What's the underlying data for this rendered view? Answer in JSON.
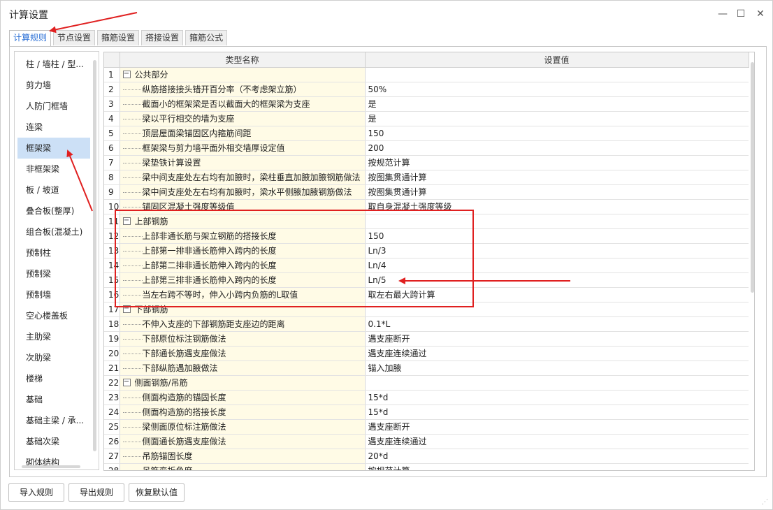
{
  "window": {
    "title": "计算设置",
    "min_glyph": "—",
    "max_glyph": "☐",
    "close_glyph": "✕"
  },
  "tabs": [
    {
      "label": "计算规则",
      "active": true
    },
    {
      "label": "节点设置",
      "active": false
    },
    {
      "label": "箍筋设置",
      "active": false
    },
    {
      "label": "搭接设置",
      "active": false
    },
    {
      "label": "箍筋公式",
      "active": false
    }
  ],
  "sidebar": {
    "items": [
      "柱 / 墙柱 / 型...",
      "剪力墙",
      "人防门框墙",
      "连梁",
      "框架梁",
      "非框架梁",
      "板 / 坡道",
      "叠合板(整厚)",
      "组合板(混凝土)",
      "预制柱",
      "预制梁",
      "预制墙",
      "空心楼盖板",
      "主肋梁",
      "次肋梁",
      "楼梯",
      "基础",
      "基础主梁 / 承...",
      "基础次梁",
      "砌体结构"
    ],
    "active_index": 4
  },
  "grid": {
    "headers": {
      "num": "",
      "name": "类型名称",
      "value": "设置值"
    },
    "rows": [
      {
        "num": "1",
        "name": "公共部分",
        "value": "",
        "group": true
      },
      {
        "num": "2",
        "name": "纵筋搭接接头错开百分率（不考虑架立筋）",
        "value": "50%",
        "group": false
      },
      {
        "num": "3",
        "name": "截面小的框架梁是否以截面大的框架梁为支座",
        "value": "是",
        "group": false
      },
      {
        "num": "4",
        "name": "梁以平行相交的墙为支座",
        "value": "是",
        "group": false
      },
      {
        "num": "5",
        "name": "顶层屋面梁锚固区内箍筋间距",
        "value": "150",
        "group": false
      },
      {
        "num": "6",
        "name": "框架梁与剪力墙平面外相交墙厚设定值",
        "value": "200",
        "group": false
      },
      {
        "num": "7",
        "name": "梁垫铁计算设置",
        "value": "按规范计算",
        "group": false
      },
      {
        "num": "8",
        "name": "梁中间支座处左右均有加腋时，梁柱垂直加腋加腋钢筋做法",
        "value": "按图集贯通计算",
        "group": false
      },
      {
        "num": "9",
        "name": "梁中间支座处左右均有加腋时，梁水平侧腋加腋钢筋做法",
        "value": "按图集贯通计算",
        "group": false
      },
      {
        "num": "10",
        "name": "锚固区混凝土强度等级值",
        "value": "取自身混凝土强度等级",
        "group": false
      },
      {
        "num": "11",
        "name": "上部钢筋",
        "value": "",
        "group": true
      },
      {
        "num": "12",
        "name": "上部非通长筋与架立钢筋的搭接长度",
        "value": "150",
        "group": false
      },
      {
        "num": "13",
        "name": "上部第一排非通长筋伸入跨内的长度",
        "value": "Ln/3",
        "group": false
      },
      {
        "num": "14",
        "name": "上部第二排非通长筋伸入跨内的长度",
        "value": "Ln/4",
        "group": false
      },
      {
        "num": "15",
        "name": "上部第三排非通长筋伸入跨内的长度",
        "value": "Ln/5",
        "group": false
      },
      {
        "num": "16",
        "name": "当左右跨不等时，伸入小跨内负筋的L取值",
        "value": "取左右最大跨计算",
        "group": false
      },
      {
        "num": "17",
        "name": "下部钢筋",
        "value": "",
        "group": true
      },
      {
        "num": "18",
        "name": "不伸入支座的下部钢筋距支座边的距离",
        "value": "0.1*L",
        "group": false
      },
      {
        "num": "19",
        "name": "下部原位标注钢筋做法",
        "value": "遇支座断开",
        "group": false
      },
      {
        "num": "20",
        "name": "下部通长筋遇支座做法",
        "value": "遇支座连续通过",
        "group": false
      },
      {
        "num": "21",
        "name": "下部纵筋遇加腋做法",
        "value": "锚入加腋",
        "group": false
      },
      {
        "num": "22",
        "name": "侧面钢筋/吊筋",
        "value": "",
        "group": true
      },
      {
        "num": "23",
        "name": "侧面构造筋的锚固长度",
        "value": "15*d",
        "group": false
      },
      {
        "num": "24",
        "name": "侧面构造筋的搭接长度",
        "value": "15*d",
        "group": false
      },
      {
        "num": "25",
        "name": "梁侧面原位标注筋做法",
        "value": "遇支座断开",
        "group": false
      },
      {
        "num": "26",
        "name": "侧面通长筋遇支座做法",
        "value": "遇支座连续通过",
        "group": false
      },
      {
        "num": "27",
        "name": "吊筋锚固长度",
        "value": "20*d",
        "group": false
      },
      {
        "num": "28",
        "name": "吊筋弯折角度",
        "value": "按规范计算",
        "group": false
      }
    ]
  },
  "buttons": {
    "import": "导入规则",
    "export": "导出规则",
    "restore": "恢复默认值"
  },
  "annotation_color": "#e02020",
  "selection_color": "#cce0f6",
  "name_cell_color": "#fffbe6"
}
